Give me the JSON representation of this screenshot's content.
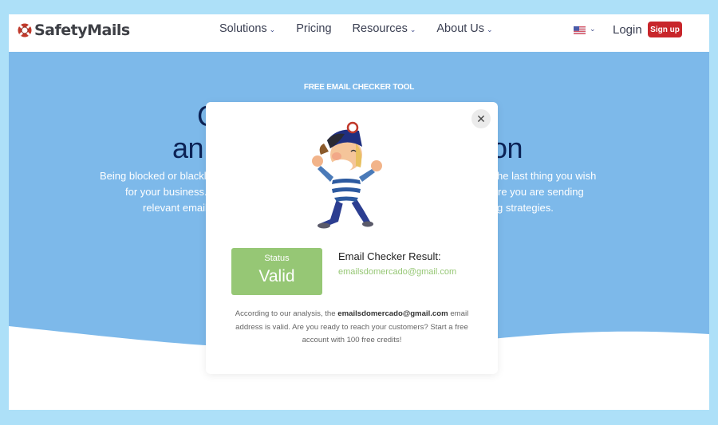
{
  "header": {
    "brand": "SafetyMails",
    "nav": [
      {
        "label": "Solutions",
        "has_dropdown": true
      },
      {
        "label": "Pricing",
        "has_dropdown": false
      },
      {
        "label": "Resources",
        "has_dropdown": true
      },
      {
        "label": "About Us",
        "has_dropdown": true
      }
    ],
    "language_icon": "us-flag-icon",
    "login_label": "Login",
    "signup_label": "Sign up",
    "signup_color": "#c8262b"
  },
  "hero": {
    "eyebrow": "FREE EMAIL CHECKER TOOL",
    "headline_line1_left": "C",
    "headline_line2_left": "an",
    "headline_line2_right": "on",
    "subtitle_lines_left": [
      "Being blocked or blackli",
      "for your business. U",
      "relevant email"
    ],
    "subtitle_lines_right": [
      "he last thing you wish",
      "re you are sending",
      "g strategies."
    ],
    "background_color": "#7db9ea"
  },
  "modal": {
    "close_icon": "close-icon",
    "mascot": "sailor-mascot-illustration",
    "status_label": "Status",
    "status_value": "Valid",
    "status_color": "#96c775",
    "result_title": "Email Checker Result:",
    "result_email": "emailsdomercado@gmail.com",
    "description_before": "According to our analysis, the ",
    "description_email": "emailsdomercado@gmail.com",
    "description_after": " email address is valid. Are you ready to reach your customers? Start a free account with 100 free credits!"
  }
}
